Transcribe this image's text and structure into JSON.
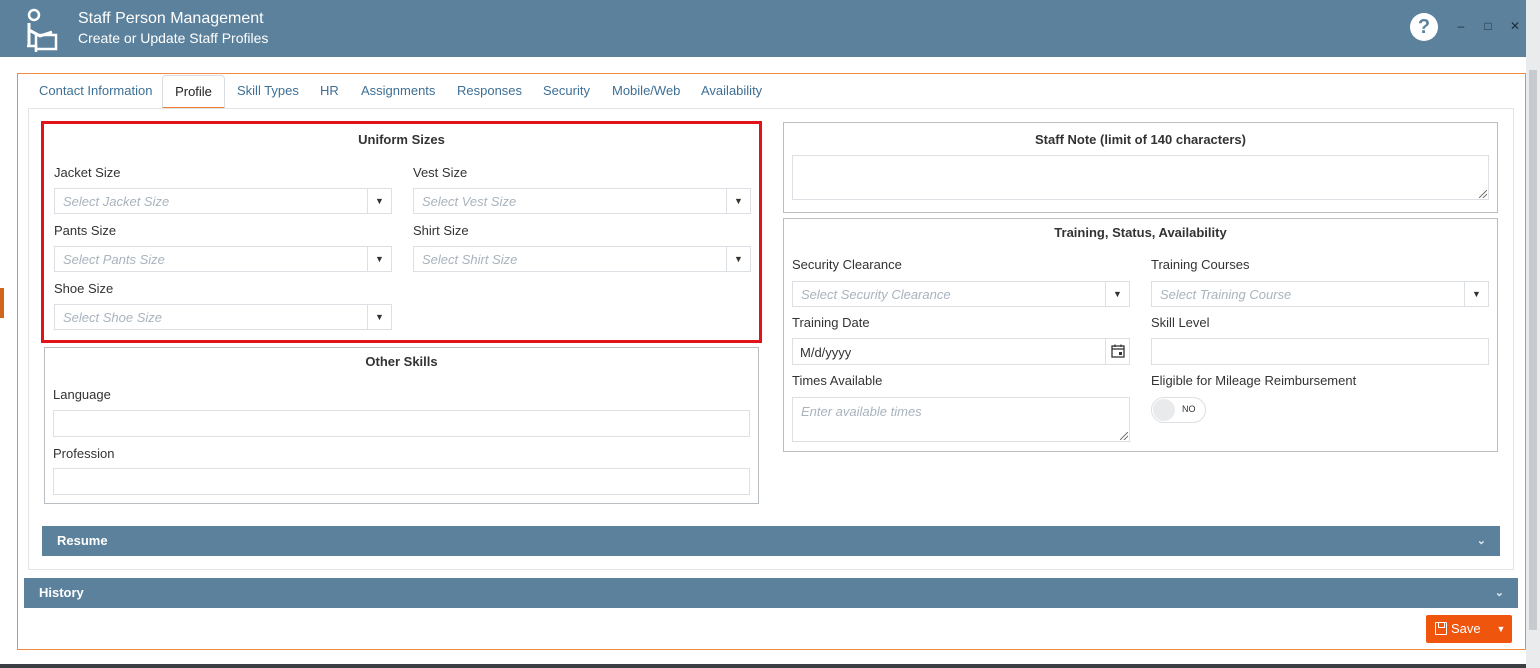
{
  "window": {
    "title": "Staff Person Management",
    "subtitle": "Create or Update Staff Profiles",
    "help_symbol": "?",
    "minimize_symbol": "–",
    "maximize_symbol": "□",
    "close_symbol": "✕"
  },
  "tabs": [
    {
      "label": "Contact Information"
    },
    {
      "label": "Profile"
    },
    {
      "label": "Skill Types"
    },
    {
      "label": "HR"
    },
    {
      "label": "Assignments"
    },
    {
      "label": "Responses"
    },
    {
      "label": "Security"
    },
    {
      "label": "Mobile/Web"
    },
    {
      "label": "Availability"
    }
  ],
  "active_tab": "Profile",
  "uniform": {
    "title": "Uniform Sizes",
    "jacket": {
      "label": "Jacket Size",
      "placeholder": "Select Jacket Size"
    },
    "vest": {
      "label": "Vest Size",
      "placeholder": "Select Vest Size"
    },
    "pants": {
      "label": "Pants Size",
      "placeholder": "Select Pants Size"
    },
    "shirt": {
      "label": "Shirt Size",
      "placeholder": "Select Shirt Size"
    },
    "shoe": {
      "label": "Shoe Size",
      "placeholder": "Select Shoe Size"
    }
  },
  "other_skills": {
    "title": "Other Skills",
    "language_label": "Language",
    "profession_label": "Profession"
  },
  "staff_note": {
    "title": "Staff Note (limit of 140 characters)"
  },
  "training": {
    "title": "Training, Status, Availability",
    "security_clearance": {
      "label": "Security Clearance",
      "placeholder": "Select Security Clearance"
    },
    "training_courses": {
      "label": "Training Courses",
      "placeholder": "Select Training Course"
    },
    "training_date": {
      "label": "Training Date",
      "value": "M/d/yyyy"
    },
    "skill_level": {
      "label": "Skill Level"
    },
    "times_available": {
      "label": "Times Available",
      "placeholder": "Enter available times"
    },
    "mileage": {
      "label": "Eligible for Mileage Reimbursement",
      "toggle_text": "NO"
    }
  },
  "sections": {
    "resume": "Resume",
    "history": "History"
  },
  "actions": {
    "save_label": "Save"
  },
  "colors": {
    "header": "#5b819c",
    "accent": "#f07b2e",
    "save_button": "#f0550e",
    "highlight_border": "#e0131a"
  },
  "icons": {
    "app": "staff-person-icon",
    "help": "help-icon",
    "dropdown": "dropdown-arrow-icon",
    "calendar": "calendar-icon",
    "chevron": "chevron-down-icon",
    "save": "floppy-disk-icon"
  }
}
